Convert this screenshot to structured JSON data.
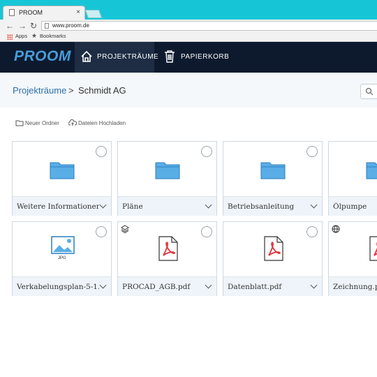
{
  "browser": {
    "tab_title": "PROOM",
    "tab_close": "×",
    "url": "www.proom.de",
    "bookmarks": [
      "Apps",
      "Bookmarks"
    ]
  },
  "app": {
    "logo": "PROOM",
    "nav": [
      {
        "label": "PROJEKTRÄUME",
        "icon": "home-icon",
        "active": true
      },
      {
        "label": "PAPIERKORB",
        "icon": "trash-icon",
        "active": false
      }
    ],
    "breadcrumb": {
      "root": "Projekträume",
      "sep": ">",
      "current": "Schmidt AG"
    },
    "actions": {
      "new_folder": "Neuer Ordner",
      "upload": "Dateien Hochladen"
    },
    "items": [
      {
        "name": "Weitere Informationen",
        "type": "folder"
      },
      {
        "name": "Pläne",
        "type": "folder"
      },
      {
        "name": "Betriebsanleitung",
        "type": "folder"
      },
      {
        "name": "Ölpumpe",
        "type": "folder"
      },
      {
        "name": "Verkabelungsplan-5-1...",
        "type": "image",
        "ext": "JPG"
      },
      {
        "name": "PROCAD_AGB.pdf",
        "type": "pdf",
        "badge": "layers-icon"
      },
      {
        "name": "Datenblatt.pdf",
        "type": "pdf"
      },
      {
        "name": "Zeichnung.pdf",
        "type": "pdf",
        "badge": "globe-icon"
      }
    ],
    "colors": {
      "nav_bg": "#0d1a2e",
      "accent": "#4a9cd8",
      "folder": "#5aaee6",
      "pdf": "#e0353c"
    }
  }
}
